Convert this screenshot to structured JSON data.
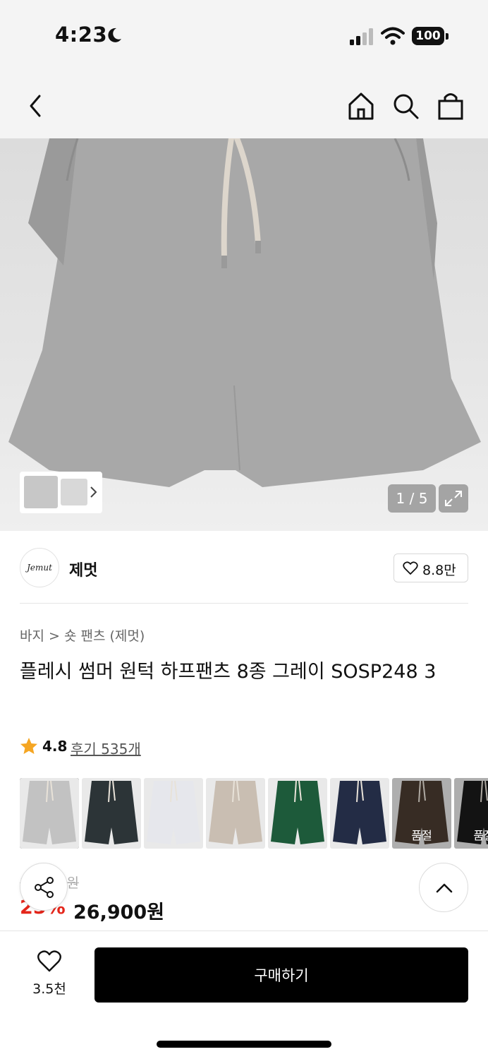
{
  "status_bar": {
    "time": "4:23",
    "battery": "100"
  },
  "gallery": {
    "counter": "1 / 5"
  },
  "brand": {
    "logo_text": "Jemut",
    "name": "제멋",
    "like_count": "8.8만"
  },
  "product": {
    "breadcrumb": "바지 > 숏 팬츠 (제멋)",
    "title": "플레시 썸머 원턱 하프팬츠 8종 그레이 SOSP248 3",
    "rating": "4.8",
    "reviews": "후기 535개",
    "original_price": "35,900원",
    "discount": "25%",
    "price": "26,900원"
  },
  "swatches": [
    {
      "color": "#c2c2c2",
      "sold_out": ""
    },
    {
      "color": "#2c3437",
      "sold_out": ""
    },
    {
      "color": "#e6e7ec",
      "sold_out": ""
    },
    {
      "color": "#c9beb2",
      "sold_out": ""
    },
    {
      "color": "#1d5a3a",
      "sold_out": ""
    },
    {
      "color": "#232c45",
      "sold_out": ""
    },
    {
      "color": "#4a3b30",
      "sold_out": "품절"
    },
    {
      "color": "#1a1a1a",
      "sold_out": "품절"
    }
  ],
  "bottom": {
    "wish_count": "3.5천",
    "buy_label": "구매하기"
  }
}
